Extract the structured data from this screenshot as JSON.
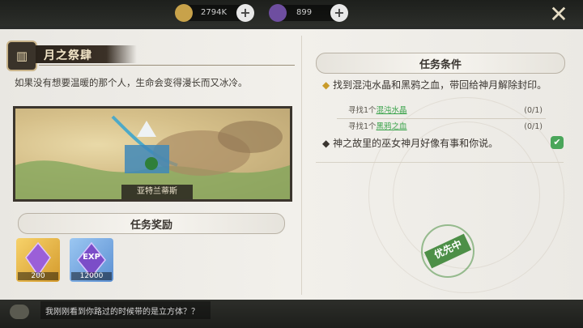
{
  "top_bar": {
    "gold_amount": "2794K",
    "gem_amount": "899",
    "plus_symbol": "+",
    "close_symbol": "✕"
  },
  "quest": {
    "title": "月之祭肆",
    "description": "如果没有想要温暖的那个人，生命会变得漫长而又冰冷。",
    "map_location": "亚特兰蒂斯"
  },
  "rewards": {
    "header": "任务奖励",
    "items": [
      {
        "icon": "purple-crystal-icon",
        "qty": "200"
      },
      {
        "icon": "exp-crystal-icon",
        "qty": "12000",
        "badge": "EXP"
      }
    ]
  },
  "conditions": {
    "header": "任务条件",
    "main": "找到混沌水晶和黑鸦之血，带回给神月解除封印。",
    "subtasks": [
      {
        "prefix": "寻找1个",
        "item": "混沌水晶",
        "count": "(0/1)"
      },
      {
        "prefix": "寻找1个",
        "item": "黑鸦之血",
        "count": "(0/1)"
      }
    ],
    "second": "神之故里的巫女神月好像有事和你说。",
    "stamp": "优先中"
  },
  "chat": {
    "message": "我刚刚看到你路过的时候带的是立方体？？"
  },
  "colors": {
    "accent_green": "#3aa34a",
    "gold": "#c99b2a",
    "dark": "#2a231b"
  }
}
